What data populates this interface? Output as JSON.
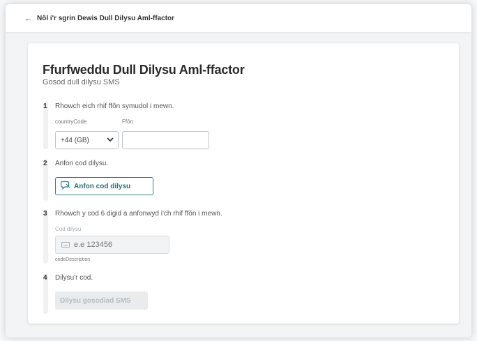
{
  "header": {
    "back_arrow": "←",
    "back_label": "Nôl i'r sgrin Dewis Dull Dilysu Aml-ffactor"
  },
  "card": {
    "title": "Ffurfweddu Dull Dilysu Aml-ffactor",
    "subtitle": "Gosod dull dilysu SMS"
  },
  "steps": [
    {
      "number": "1",
      "text": "Rhowch eich rhif ffôn symudol i mewn.",
      "country_label": "countryCode",
      "country_value": "+44 (GB)",
      "phone_label": "Ffôn",
      "phone_value": ""
    },
    {
      "number": "2",
      "text": "Anfon cod dilysu.",
      "button_label": "Anfon cod dilysu"
    },
    {
      "number": "3",
      "text": "Rhowch y cod 6 digid a anfonwyd i'ch rhif ffôn i mewn.",
      "code_label": "Cod dilysu",
      "code_placeholder": "e.e 123456",
      "code_description": "codeDescription"
    },
    {
      "number": "4",
      "text": "Dilysu'r cod.",
      "button_label": "Dilysu gosodiad SMS"
    }
  ],
  "icons": {
    "back": "arrow-left-icon",
    "chevron": "chevron-down-icon",
    "send": "message-icon",
    "keyboard": "keyboard-icon"
  },
  "colors": {
    "accent": "#2e7f86",
    "disabled_text": "#b7bcc0"
  }
}
